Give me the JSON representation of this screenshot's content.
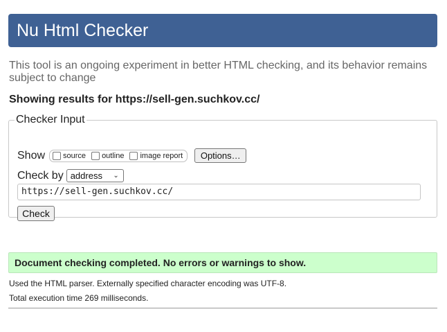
{
  "header": {
    "title": "Nu Html Checker"
  },
  "intro": {
    "text": "This tool is an ongoing experiment in better HTML checking, and its behavior remains subject to change"
  },
  "results_for": {
    "text": "Showing results for https://sell-gen.suchkov.cc/"
  },
  "checker_input": {
    "legend": "Checker Input",
    "show_label": "Show",
    "options": [
      {
        "label": "source",
        "checked": false
      },
      {
        "label": "outline",
        "checked": false
      },
      {
        "label": "image report",
        "checked": false
      }
    ],
    "options_button": "Options…",
    "check_by_label": "Check by",
    "check_by_value": "address",
    "url_value": "https://sell-gen.suchkov.cc/",
    "check_button": "Check"
  },
  "result": {
    "success_message": "Document checking completed. No errors or warnings to show.",
    "parser_note": "Used the HTML parser. Externally specified character encoding was UTF-8.",
    "execution_time": "Total execution time 269 milliseconds."
  },
  "colors": {
    "header_bg": "#3f6194",
    "success_bg": "#ccffcc"
  }
}
